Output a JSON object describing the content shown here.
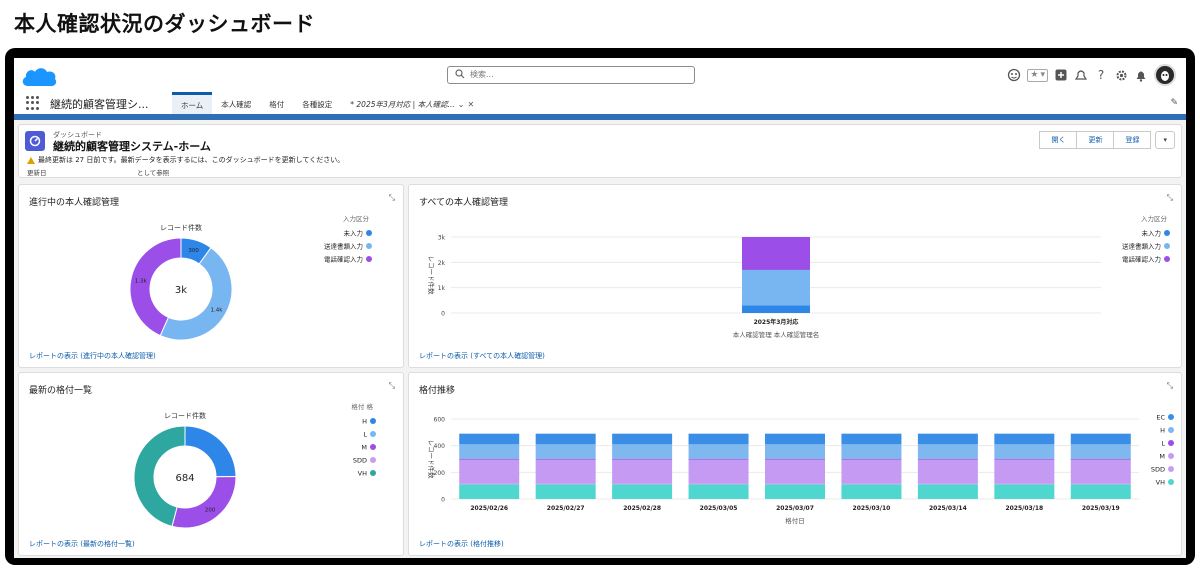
{
  "page_title": "本人確認状況のダッシュボード",
  "header": {
    "search_placeholder": "検索...",
    "icons": [
      "salesforce-cloud-logo",
      "search-icon",
      "astro-icon",
      "star-icon",
      "chevron-down-icon",
      "plus-icon",
      "bell-cloud-icon",
      "help-icon",
      "gear-icon",
      "notification-bell-icon",
      "avatar"
    ],
    "help_glyph": "?"
  },
  "appnav": {
    "app_name": "継続的顧客管理シ...",
    "tabs": [
      {
        "label": "ホーム",
        "active": true
      },
      {
        "label": "本人確認"
      },
      {
        "label": "格付"
      },
      {
        "label": "各種設定"
      },
      {
        "label": "* 2025年3月対応 | 本人確認..."
      }
    ]
  },
  "dashboard": {
    "kind": "ダッシュボード",
    "title": "継続的顧客管理システム-ホーム",
    "warning": "最終更新は 27 日前です。最新データを表示するには、このダッシュボードを更新してください。",
    "meta_updated": "更新日",
    "meta_viewas": "として参照",
    "buttons": {
      "open": "開く",
      "refresh": "更新",
      "subscribe": "登録",
      "menu": "▾"
    }
  },
  "colors": {
    "blue": "#2e86e8",
    "lightblue": "#78b6f2",
    "purple": "#9b4fe8",
    "lavender": "#c99bf3",
    "teal": "#2ea7a0",
    "ec_blue": "#3b8ee6",
    "h_blue": "#7fb8ef",
    "m_lav": "#c49af2",
    "vh_teal": "#4fd6cf",
    "brand": "#0b5cab",
    "sf_cloud": "#1b96ff"
  },
  "panels": {
    "p1": {
      "title": "進行中の本人確認管理",
      "link": "レポートの表示 (進行中の本人確認管理)"
    },
    "p2": {
      "title": "すべての本人確認管理",
      "link": "レポートの表示 (すべての本人確認管理)"
    },
    "p3": {
      "title": "最新の格付一覧",
      "link": "レポートの表示 (最新の格付一覧)"
    },
    "p4": {
      "title": "格付推移",
      "link": "レポートの表示 (格付推移)"
    }
  },
  "chart_data": [
    {
      "type": "pie",
      "variant": "donut",
      "subtitle": "レコード件数",
      "center_label": "3k",
      "legend_title": "入力区分",
      "legend_position": "right",
      "slices": [
        {
          "label": "未入力",
          "value": 300,
          "data_label": "300",
          "color": "#2e86e8"
        },
        {
          "label": "送達書類入力",
          "value": 1400,
          "data_label": "1.4k",
          "color": "#78b6f2"
        },
        {
          "label": "電話確認入力",
          "value": 1300,
          "data_label": "1.3k",
          "color": "#9b4fe8"
        }
      ]
    },
    {
      "type": "bar",
      "stacked": true,
      "ylabel": "レコード件数",
      "xlabel": "本人確認管理 本人確認管理名",
      "ylim": [
        0,
        3000
      ],
      "yticks": [
        "0",
        "1k",
        "2k",
        "3k"
      ],
      "categories": [
        "2025年3月対応"
      ],
      "legend_title": "入力区分",
      "legend_position": "right",
      "series": [
        {
          "name": "未入力",
          "values": [
            300
          ],
          "color": "#2e86e8"
        },
        {
          "name": "送達書類入力",
          "values": [
            1400
          ],
          "color": "#78b6f2"
        },
        {
          "name": "電話確認入力",
          "values": [
            1300
          ],
          "color": "#9b4fe8"
        }
      ]
    },
    {
      "type": "pie",
      "variant": "donut",
      "subtitle": "レコード件数",
      "center_label": "684",
      "legend_title": "格付 格",
      "legend_position": "right",
      "slices": [
        {
          "label": "H",
          "value": 170,
          "data_label": "",
          "color": "#2e86e8"
        },
        {
          "label": "L",
          "value": 0,
          "data_label": "",
          "color": "#78b6f2"
        },
        {
          "label": "M",
          "value": 200,
          "data_label": "200",
          "color": "#9b4fe8"
        },
        {
          "label": "SDD",
          "value": 0,
          "data_label": "",
          "color": "#c99bf3"
        },
        {
          "label": "VH",
          "value": 314,
          "data_label": "",
          "color": "#2ea7a0"
        }
      ]
    },
    {
      "type": "bar",
      "stacked": true,
      "ylabel": "レコード件数",
      "xlabel": "格付日",
      "ylim": [
        0,
        600
      ],
      "yticks": [
        "0",
        "200",
        "400",
        "600"
      ],
      "categories": [
        "2025/02/26",
        "2025/02/27",
        "2025/02/28",
        "2025/03/05",
        "2025/03/07",
        "2025/03/10",
        "2025/03/14",
        "2025/03/18",
        "2025/03/19"
      ],
      "legend_position": "right",
      "series": [
        {
          "name": "VH",
          "values": [
            110,
            110,
            110,
            110,
            110,
            110,
            110,
            110,
            110
          ],
          "color": "#4fd6cf"
        },
        {
          "name": "SDD",
          "values": [
            5,
            5,
            5,
            5,
            5,
            5,
            5,
            5,
            5
          ],
          "color": "#c99bf3"
        },
        {
          "name": "M",
          "values": [
            180,
            180,
            180,
            180,
            180,
            180,
            180,
            180,
            180
          ],
          "color": "#c49af2"
        },
        {
          "name": "L",
          "values": [
            5,
            5,
            5,
            5,
            5,
            5,
            5,
            5,
            5
          ],
          "color": "#9b4fe8"
        },
        {
          "name": "H",
          "values": [
            110,
            110,
            110,
            110,
            110,
            110,
            110,
            110,
            110
          ],
          "color": "#7fb8ef"
        },
        {
          "name": "EC",
          "values": [
            80,
            80,
            80,
            80,
            80,
            80,
            80,
            80,
            80
          ],
          "color": "#3b8ee6"
        }
      ],
      "legend_order": [
        "EC",
        "H",
        "L",
        "M",
        "SDD",
        "VH"
      ]
    }
  ]
}
